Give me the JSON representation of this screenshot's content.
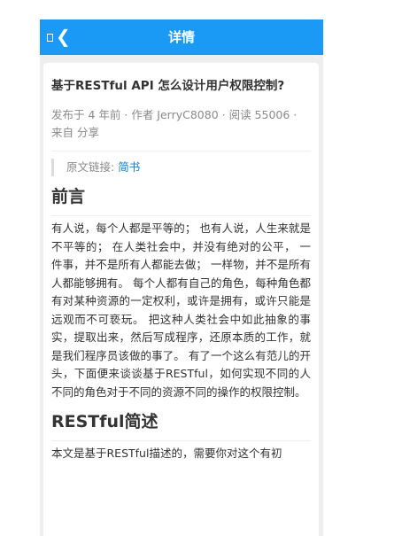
{
  "header": {
    "title": "详情",
    "back_icon": "chevron-left-icon"
  },
  "article": {
    "title": "基于RESTful API 怎么设计用户权限控制?",
    "meta": "发布于 4 年前 · 作者 JerryC8080 · 阅读 55006 · 来自 分享",
    "source_label": "原文链接:",
    "source_link": "简书",
    "h1": "前言",
    "p1": "有人说，每个人都是平等的； 也有人说，人生来就是不平等的； 在人类社会中，并没有绝对的公平， 一件事，并不是所有人都能去做； 一样物，并不是所有人都能够拥有。 每个人都有自己的角色，每种角色都有对某种资源的一定权利，或许是拥有，或许只能是远观而不可亵玩。 把这种人类社会中如此抽象的事实，提取出来，然后写成程序，还原本质的工作，就是我们程序员该做的事了。 有了一个这么有范儿的开头，下面便来谈谈基于RESTful，如何实现不同的人不同的角色对于不同的资源不同的操作的权限控制。",
    "h2": "RESTful简述",
    "p2": "本文是基于RESTful描述的，需要你对这个有初"
  },
  "colors": {
    "appbar": "#1a9af4",
    "link": "#1a7ec8"
  }
}
